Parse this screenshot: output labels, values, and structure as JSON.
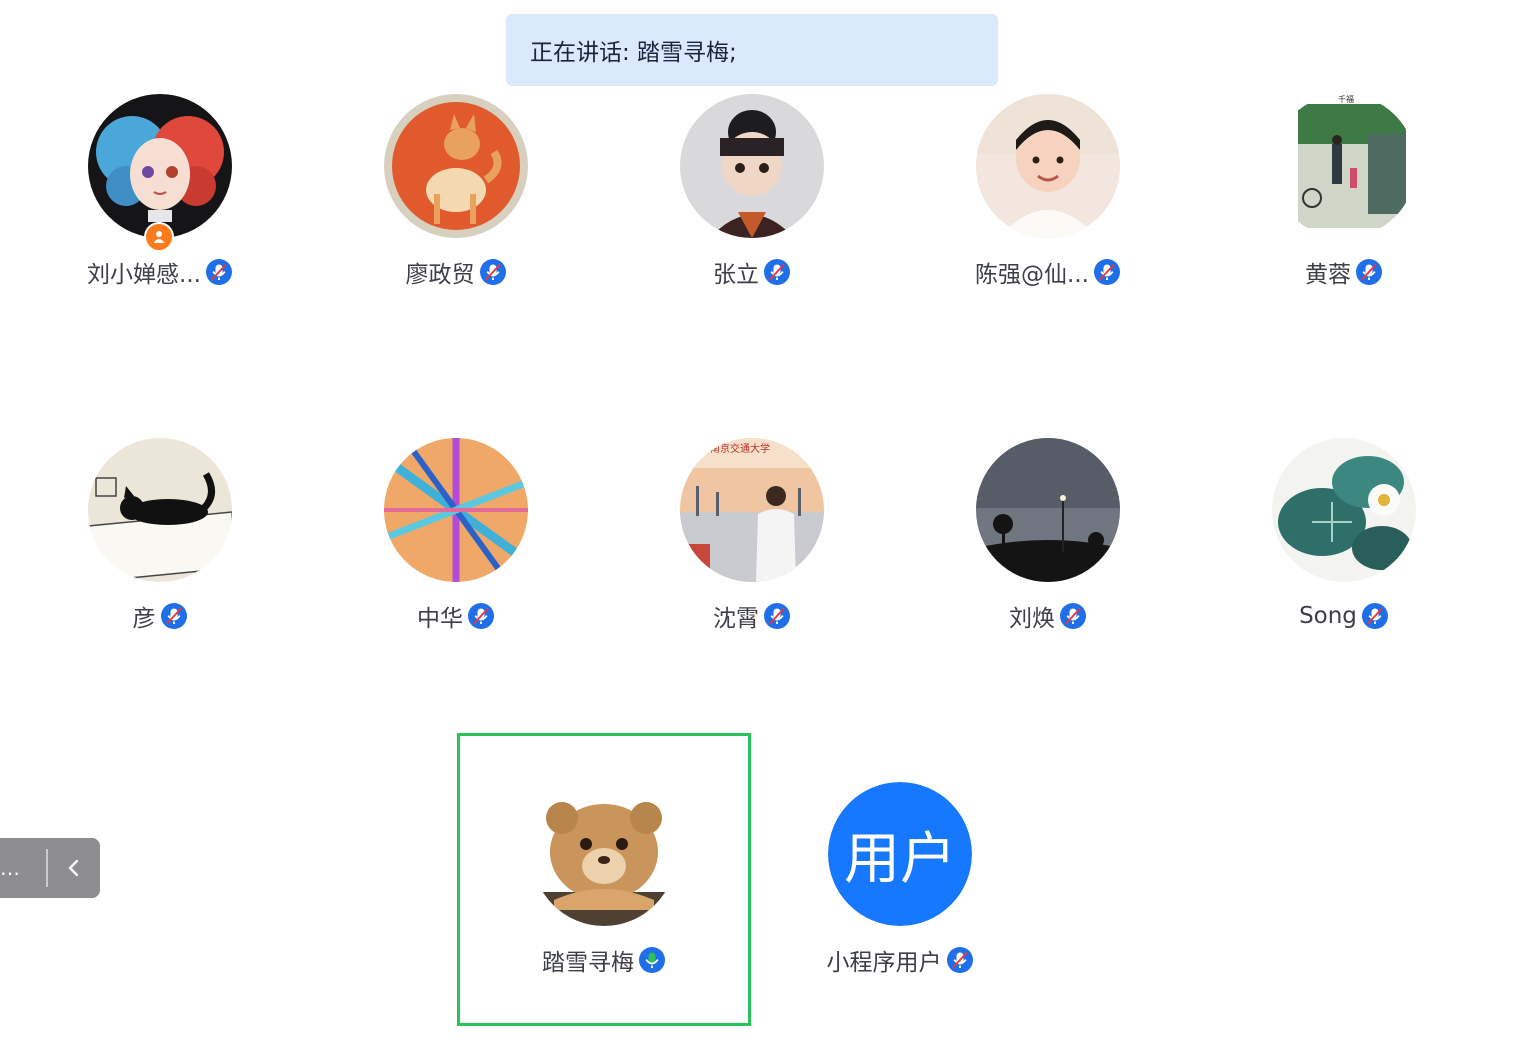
{
  "banner": {
    "text": "正在讲话: 踏雪寻梅;"
  },
  "participants": [
    {
      "name": "刘小婵感...",
      "avatar_icon": "cartoon-girl-avatar",
      "host": true,
      "mic": "muted"
    },
    {
      "name": "廖政贸",
      "avatar_icon": "shiba-dog-avatar",
      "host": false,
      "mic": "muted"
    },
    {
      "name": "张立",
      "avatar_icon": "doll-figure-avatar",
      "host": false,
      "mic": "muted"
    },
    {
      "name": "陈强@仙...",
      "avatar_icon": "child-photo-avatar",
      "host": false,
      "mic": "muted"
    },
    {
      "name": "黄蓉",
      "avatar_icon": "street-photo-avatar",
      "host": false,
      "mic": "muted"
    },
    {
      "name": "彦",
      "avatar_icon": "black-cat-avatar",
      "host": false,
      "mic": "muted"
    },
    {
      "name": "中华",
      "avatar_icon": "rainbow-rays-avatar",
      "host": false,
      "mic": "muted"
    },
    {
      "name": "沈霄",
      "avatar_icon": "harbor-photo-avatar",
      "host": false,
      "mic": "muted"
    },
    {
      "name": "刘焕",
      "avatar_icon": "dusk-palms-avatar",
      "host": false,
      "mic": "muted"
    },
    {
      "name": "Song",
      "avatar_icon": "lotus-leaf-avatar",
      "host": false,
      "mic": "muted"
    },
    {
      "name": "踏雪寻梅",
      "avatar_icon": "lion-cub-avatar",
      "host": false,
      "mic": "speaking"
    },
    {
      "name": "小程序用户",
      "avatar_icon": "text-placeholder-avatar",
      "avatar_text": "用户",
      "host": false,
      "mic": "muted"
    }
  ],
  "side_panel": {
    "label": "…",
    "collapse_icon": "chevron-left-icon"
  },
  "colors": {
    "banner_bg": "#dbe9fc",
    "mic_muted": "#1f6fe8",
    "mic_speaking": "#2fbf5b",
    "host_badge": "#ff7a1a",
    "active_frame": "#28c45a",
    "placeholder_avatar": "#1677ff"
  }
}
